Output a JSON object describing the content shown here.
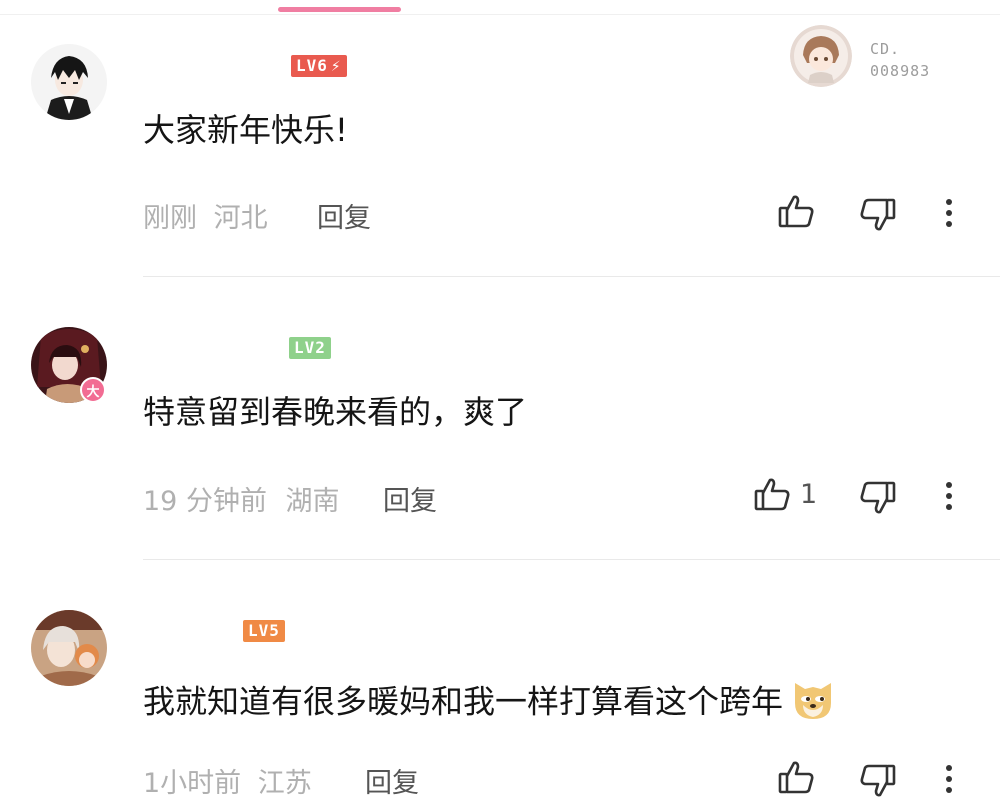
{
  "colors": {
    "accent": "#f07ea2",
    "lv6": "#e95a4f",
    "lv2": "#8fd18b",
    "lv5": "#f08a45"
  },
  "comments": [
    {
      "level": "LV6",
      "text": "大家新年快乐!",
      "time": "刚刚",
      "location": "河北",
      "reply_label": "回复",
      "fan_badge_prefix": "CD.",
      "fan_badge_number": "008983"
    },
    {
      "level": "LV2",
      "vip_badge": "大",
      "text": "特意留到春晚来看的，爽了",
      "time": "19 分钟前",
      "location": "湖南",
      "reply_label": "回复",
      "likes": "1"
    },
    {
      "level": "LV5",
      "text": "我就知道有很多暖妈和我一样打算看这个跨年",
      "emoji": "doge-emoji",
      "time": "1小时前",
      "location": "江苏",
      "reply_label": "回复"
    }
  ]
}
